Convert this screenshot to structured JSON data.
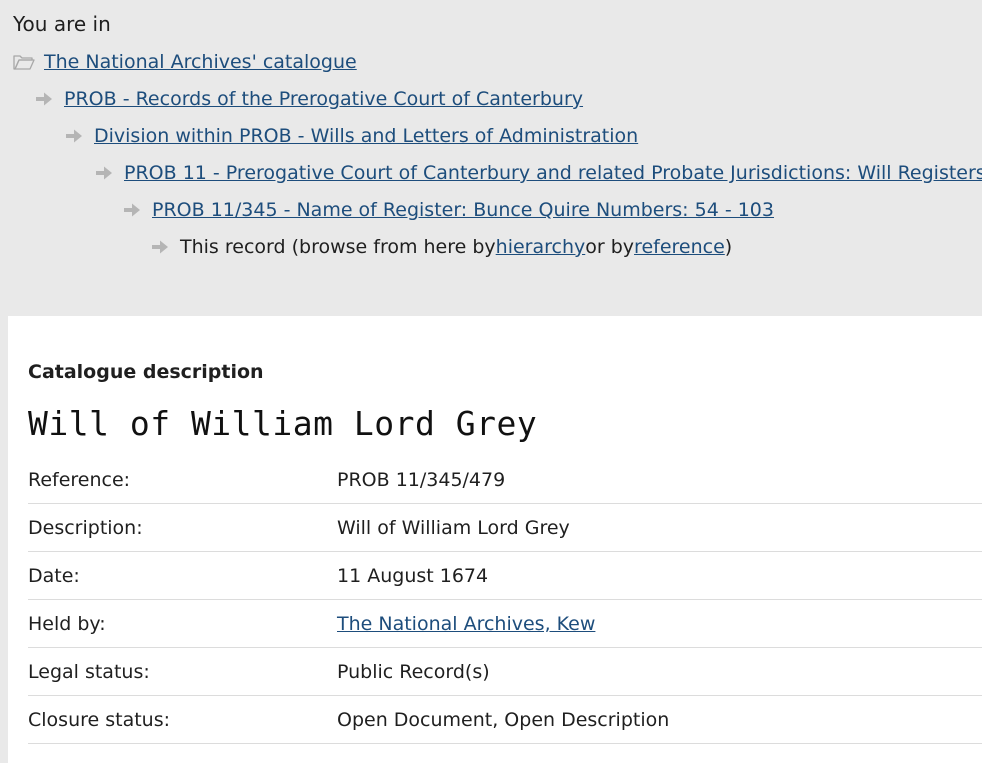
{
  "breadcrumb": {
    "heading": "You are in",
    "items": [
      {
        "label": "The National Archives' catalogue",
        "icon": "folder-icon"
      },
      {
        "label": "PROB - Records of the Prerogative Court of Canterbury",
        "icon": "arrow-right-icon"
      },
      {
        "label": "Division within PROB - Wills and Letters of Administration",
        "icon": "arrow-right-icon"
      },
      {
        "label": "PROB 11 - Prerogative Court of Canterbury and related Probate Jurisdictions: Will Registers",
        "icon": "arrow-right-icon"
      },
      {
        "label": "PROB 11/345 - Name of Register: Bunce Quire Numbers: 54 - 103",
        "icon": "arrow-right-icon"
      }
    ],
    "current": {
      "prefix": "This record (browse from here by ",
      "hierarchy_link": "hierarchy",
      "middle": " or by ",
      "reference_link": "reference",
      "suffix": ")"
    }
  },
  "catalogue": {
    "section_label": "Catalogue description",
    "title": "Will of William Lord Grey",
    "rows": [
      {
        "label": "Reference:",
        "value": "PROB 11/345/479"
      },
      {
        "label": "Description:",
        "value": "Will of William Lord Grey"
      },
      {
        "label": "Date:",
        "value": "11 August 1674"
      },
      {
        "label": "Held by:",
        "value": "The National Archives, Kew"
      },
      {
        "label": "Legal status:",
        "value": "Public Record(s)"
      },
      {
        "label": "Closure status:",
        "value": "Open Document, Open Description"
      }
    ]
  },
  "colors": {
    "link": "#1d4d7c",
    "breadcrumb_bg": "#e9e9e9",
    "content_bg": "#ffffff",
    "divider": "#dcdcdc",
    "icon": "#b5b5b5"
  }
}
